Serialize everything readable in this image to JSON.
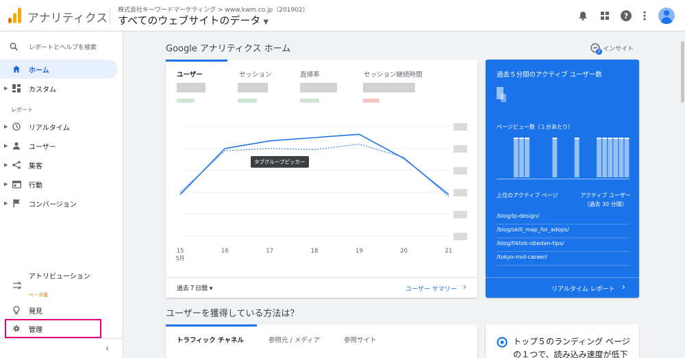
{
  "header": {
    "app_name": "アナリティクス",
    "account": "株式会社キーワードマーケティング > www.kwm.co.jp（201902）",
    "property": "すべてのウェブサイトのデータ",
    "icons": [
      "bell-icon",
      "apps-grid-icon",
      "help-icon",
      "more-vert-icon",
      "account-avatar"
    ],
    "logo_colors": [
      "#f9ab00",
      "#e37400"
    ]
  },
  "sidebar": {
    "search_placeholder": "レポートとヘルプを検索",
    "home": "ホーム",
    "custom": "カスタム",
    "reports_label": "レポート",
    "items": [
      {
        "label": "リアルタイム",
        "icon": "clock-icon"
      },
      {
        "label": "ユーザー",
        "icon": "person-icon"
      },
      {
        "label": "集客",
        "icon": "acquisition-icon"
      },
      {
        "label": "行動",
        "icon": "behavior-icon"
      },
      {
        "label": "コンバージョン",
        "icon": "flag-icon"
      }
    ],
    "attribution": "アトリビューション",
    "beta": "ベータ版",
    "discover": "発見",
    "admin": "管理",
    "highlight_color": "#e6007e"
  },
  "main": {
    "title": "Google アナリティクス ホーム",
    "insight_label": "インサイト",
    "insight_count": "2",
    "tabs": [
      "ユーザー",
      "セッション",
      "直帰率",
      "セッション継続時間"
    ],
    "tooltip": "タブグループピッカー",
    "date_range": "過去７日間",
    "summary_link": "ユーザー サマリー",
    "accent_color": "#1a73e8"
  },
  "chart_data": {
    "type": "line",
    "x_labels": [
      "15",
      "16",
      "17",
      "18",
      "19",
      "20",
      "21"
    ],
    "x_sublabel": "5月",
    "series": [
      {
        "style": "solid",
        "values": [
          0.38,
          0.8,
          0.87,
          0.9,
          0.93,
          0.71,
          0.38
        ]
      },
      {
        "style": "dashed",
        "values": [
          0.4,
          0.78,
          0.8,
          0.79,
          0.84,
          0.72,
          0.36
        ]
      }
    ],
    "ylim": [
      0,
      1
    ],
    "grid": true,
    "y_tick_labels_visible": false
  },
  "realtime": {
    "title": "過去５分間のアクティブ ユーザー数",
    "pageview_label": "ページビュー数（１分あたり）",
    "pageview_bars": [
      0,
      0,
      0,
      1,
      1,
      1,
      0,
      0,
      0,
      0,
      1,
      0,
      0,
      0,
      1,
      0,
      0,
      0,
      1,
      1,
      1,
      1,
      1,
      1
    ],
    "top_pages_label": "上位のアクティブ ページ",
    "active_users_label": "アクティブ ユーザー（過去 30 分間）",
    "pages": [
      "/blog/lp-design/",
      "/blog/skill_map_for_adops/",
      "/blog/tiktok-obedan-tips/",
      "/tokyo-mid-career/"
    ],
    "link": "リアルタイム レポート"
  },
  "acquisition": {
    "title": "ユーザーを獲得している方法は？",
    "tabs": [
      "トラフィック チャネル",
      "参照元 / メディア",
      "参照サイト"
    ]
  },
  "landing": {
    "text": "トップ５のランディング ページの１つで、読み込み速度が低下"
  }
}
